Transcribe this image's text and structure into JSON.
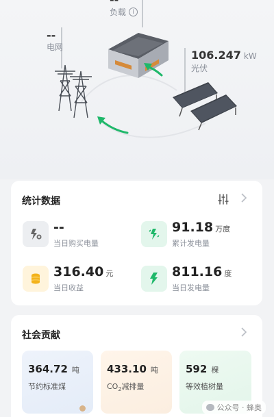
{
  "diagram": {
    "load": {
      "value": "--",
      "label": "负载"
    },
    "grid": {
      "value": "--",
      "label": "电网"
    },
    "pv": {
      "value": "106.247",
      "unit": "kW",
      "label": "光伏"
    }
  },
  "stats": {
    "title": "统计数据",
    "items": [
      {
        "value": "--",
        "unit": "",
        "label": "当日购买电量",
        "icon": "grid-purchase-icon"
      },
      {
        "value": "91.18",
        "unit": "万度",
        "label": "累计发电量",
        "icon": "lightning-double-icon"
      },
      {
        "value": "316.40",
        "unit": "元",
        "label": "当日收益",
        "icon": "coins-icon"
      },
      {
        "value": "811.16",
        "unit": "度",
        "label": "当日发电量",
        "icon": "lightning-icon"
      }
    ]
  },
  "social": {
    "title": "社会贡献",
    "items": [
      {
        "value": "364.72",
        "unit": "吨",
        "label": "节约标准煤"
      },
      {
        "value": "433.10",
        "unit": "吨",
        "label_main": "CO",
        "label_sub": "2",
        "label_rest": "减排量"
      },
      {
        "value": "592",
        "unit": "棵",
        "label": "等效植树量"
      }
    ]
  },
  "watermark": "公众号 · 蜂奥",
  "colors": {
    "accent": "#1fb86a",
    "icon_bg_green": "#e3f6ec",
    "icon_bg_gray": "#eceef1",
    "icon_bg_yellow": "#fff4dc"
  }
}
